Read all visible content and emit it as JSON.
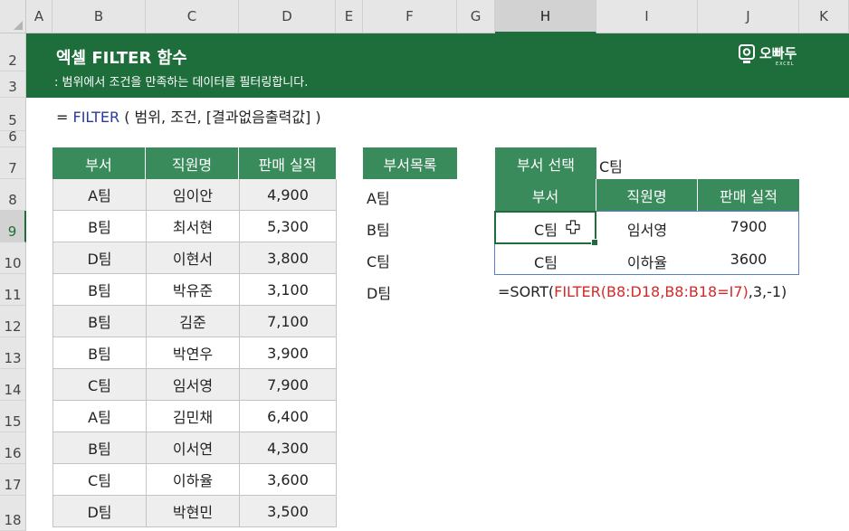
{
  "columns": [
    "A",
    "B",
    "C",
    "D",
    "E",
    "F",
    "G",
    "H",
    "I",
    "J",
    "K"
  ],
  "rows": [
    "2",
    "3",
    "5",
    "6",
    "7",
    "8",
    "9",
    "10",
    "11",
    "12",
    "13",
    "14",
    "15",
    "16",
    "17",
    "18"
  ],
  "banner": {
    "title": "엑셀 FILTER 함수",
    "subtitle": ": 범위에서 조건을 만족하는 데이터를 필터링합니다.",
    "brand_name": "오빠두",
    "brand_sub": "EXCEL"
  },
  "syntax": {
    "prefix": "= ",
    "fn": "FILTER",
    "args": " ( 범위, 조건, [결과없음출력값] )"
  },
  "main_table": {
    "headers": [
      "부서",
      "직원명",
      "판매 실적"
    ],
    "rows": [
      [
        "A팀",
        "임이안",
        "4,900"
      ],
      [
        "B팀",
        "최서현",
        "5,300"
      ],
      [
        "D팀",
        "이현서",
        "3,800"
      ],
      [
        "B팀",
        "박유준",
        "3,100"
      ],
      [
        "B팀",
        "김준",
        "7,100"
      ],
      [
        "B팀",
        "박연우",
        "3,900"
      ],
      [
        "C팀",
        "임서영",
        "7,900"
      ],
      [
        "A팀",
        "김민채",
        "6,400"
      ],
      [
        "B팀",
        "이서연",
        "4,300"
      ],
      [
        "C팀",
        "이하율",
        "3,600"
      ],
      [
        "D팀",
        "박현민",
        "3,500"
      ]
    ]
  },
  "dept_list": {
    "header": "부서목록",
    "items": [
      "A팀",
      "B팀",
      "C팀",
      "D팀"
    ]
  },
  "selector": {
    "label": "부서 선택",
    "value": "C팀"
  },
  "result_table": {
    "headers": [
      "부서",
      "직원명",
      "판매 실적"
    ],
    "rows": [
      [
        "C팀",
        "임서영",
        "7900"
      ],
      [
        "C팀",
        "이하율",
        "3600"
      ]
    ]
  },
  "formula": {
    "part1": "=SORT(",
    "part2": "FILTER(B8:D18,B8:B18=I7)",
    "part3": ",3,-1)"
  },
  "colors": {
    "banner": "#1e6e3c",
    "table_header": "#3a8b5b",
    "formula_ref": "#d42a2a"
  },
  "icons": [
    "brand-logo-icon",
    "cell-cursor-icon"
  ]
}
